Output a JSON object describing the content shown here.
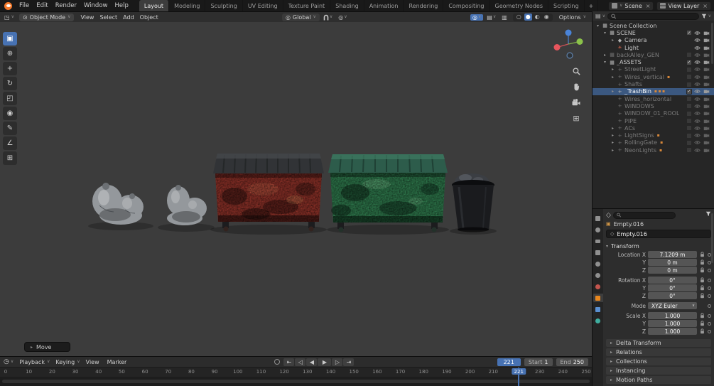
{
  "theme": {
    "bg_topbar": "#191919",
    "bg_header": "#2e2e2e",
    "bg_viewport": "#3c3c3c",
    "bg_panel": "#2d2d2d",
    "bg_outliner": "#262626",
    "bg_field": "#555555",
    "accent": "#4772b3",
    "selection": "#3b5880",
    "text": "#d4d4d4",
    "text_dim": "#8a8a8a",
    "axis_x": "#e8555d",
    "axis_y": "#8bc24a",
    "axis_z": "#4a84d9",
    "dumpster_red": "#8c3128",
    "dumpster_green": "#2f7a4d",
    "bag_gray": "#94989c",
    "can_black": "#1a1b1e"
  },
  "glyphs": {
    "chevron": "∨",
    "close": "×",
    "tree_open": "▾",
    "tree_closed": "▸",
    "editor_3d": "◳",
    "mode_icon": "⊙",
    "clock": "◷",
    "grid": "⊞",
    "proportional": "◎",
    "gizmo": "◎",
    "overlays": "▤",
    "xray": "▥",
    "object_box": "▣",
    "object_data": "◇",
    "list": "▤"
  },
  "topbar": {
    "menus": [
      {
        "label": "File"
      },
      {
        "label": "Edit"
      },
      {
        "label": "Render"
      },
      {
        "label": "Window"
      },
      {
        "label": "Help"
      }
    ],
    "workspaces": [
      {
        "label": "Layout",
        "cls": "active"
      },
      {
        "label": "Modeling"
      },
      {
        "label": "Sculpting"
      },
      {
        "label": "UV Editing"
      },
      {
        "label": "Texture Paint"
      },
      {
        "label": "Shading"
      },
      {
        "label": "Animation"
      },
      {
        "label": "Rendering"
      },
      {
        "label": "Compositing"
      },
      {
        "label": "Geometry Nodes"
      },
      {
        "label": "Scripting"
      },
      {
        "label": "+",
        "cls": "add"
      }
    ],
    "scene_label": "Scene",
    "view_layer_label": "View Layer"
  },
  "viewport_header": {
    "mode": "Object Mode",
    "menus": [
      {
        "label": "View"
      },
      {
        "label": "Select"
      },
      {
        "label": "Add"
      },
      {
        "label": "Object"
      }
    ],
    "orientation": "Global",
    "shading": [
      {
        "name": "shading-wireframe-icon",
        "glyph": "○"
      },
      {
        "name": "shading-solid-icon",
        "glyph": "●",
        "cls": "on"
      },
      {
        "name": "shading-material-icon",
        "glyph": "◐"
      },
      {
        "name": "shading-rendered-icon",
        "glyph": "◉"
      }
    ],
    "options_label": "Options"
  },
  "toolbar": {
    "tools": [
      {
        "name": "tool-select-box",
        "glyph": "▣",
        "cls": "active"
      },
      {
        "name": "tool-cursor",
        "glyph": "⊕"
      },
      {
        "name": "tool-move",
        "glyph": "+"
      },
      {
        "name": "tool-rotate",
        "glyph": "↻"
      },
      {
        "name": "tool-scale",
        "glyph": "◰"
      },
      {
        "name": "tool-transform",
        "glyph": "◉"
      },
      {
        "name": "tool-annotate",
        "glyph": "✎"
      },
      {
        "name": "tool-measure",
        "glyph": "∠"
      },
      {
        "name": "tool-add-cube",
        "glyph": "⊞"
      }
    ]
  },
  "viewport": {
    "operator_label": "Move",
    "objects": [
      {
        "name": "trash-bags-left"
      },
      {
        "name": "trash-bags-center"
      },
      {
        "name": "dumpster-red"
      },
      {
        "name": "dumpster-green"
      },
      {
        "name": "trash-can"
      }
    ]
  },
  "outliner": {
    "search_placeholder": "",
    "rows": [
      {
        "label": "Scene Collection",
        "icon": "▦",
        "arrow": "▾",
        "cls": "ind0 noicons",
        "check": ""
      },
      {
        "label": "SCENE",
        "icon": "▦",
        "arrow": "▾",
        "cls": "ind1",
        "check": "✓"
      },
      {
        "label": "Camera",
        "icon": "◆",
        "arrow": "▸",
        "cls": "ind2 nocheck"
      },
      {
        "label": "Light",
        "icon": "☀",
        "icon_cls": "c-light",
        "arrow": "",
        "cls": "ind2 nocheck"
      },
      {
        "label": "backAlley_GEN",
        "icon": "▦",
        "arrow": "▸",
        "cls": "ind1 dim",
        "check": ""
      },
      {
        "label": "_ASSETS",
        "icon": "▦",
        "arrow": "▾",
        "cls": "ind1",
        "check": "✓"
      },
      {
        "label": "StreetLight",
        "icon": "+",
        "arrow": "▸",
        "cls": "ind2 dim",
        "check": ""
      },
      {
        "label": "Wires_vertical",
        "icon": "+",
        "arrow": "▸",
        "cls": "ind2 dim",
        "check": "",
        "extras": "▪"
      },
      {
        "label": "Shafts",
        "icon": "+",
        "arrow": "",
        "cls": "ind2 dim",
        "check": ""
      },
      {
        "label": "_TrashBin",
        "icon": "+",
        "arrow": "▸",
        "cls": "ind2 sel",
        "check": "✓",
        "extras": "▪▪▪"
      },
      {
        "label": "Wires_horizontal",
        "icon": "+",
        "arrow": "",
        "cls": "ind2 dim",
        "check": ""
      },
      {
        "label": "WINDOWS",
        "icon": "+",
        "arrow": "",
        "cls": "ind2 dim",
        "check": ""
      },
      {
        "label": "WINDOW_01_ROOL",
        "icon": "+",
        "arrow": "",
        "cls": "ind2 dim",
        "check": ""
      },
      {
        "label": "PIPE",
        "icon": "+",
        "arrow": "",
        "cls": "ind2 dim",
        "check": ""
      },
      {
        "label": "ACs",
        "icon": "+",
        "arrow": "▸",
        "cls": "ind2 dim",
        "check": ""
      },
      {
        "label": "LightSigns",
        "icon": "+",
        "arrow": "▸",
        "cls": "ind2 dim",
        "check": "",
        "extras": "▪"
      },
      {
        "label": "RollingGate",
        "icon": "+",
        "arrow": "▸",
        "cls": "ind2 dim",
        "check": "",
        "extras": "▪"
      },
      {
        "label": "NeonLights",
        "icon": "+",
        "arrow": "▸",
        "cls": "ind2 dim",
        "check": "",
        "extras": "▪"
      }
    ]
  },
  "properties": {
    "tabs": [
      {
        "name": "tab-tool",
        "style": "background:#909090"
      },
      {
        "name": "tab-render",
        "style": "background:#909090;border-radius:50%"
      },
      {
        "name": "tab-output",
        "style": "background:#909090;height:5px"
      },
      {
        "name": "tab-view-layer",
        "style": "background:#909090"
      },
      {
        "name": "tab-scene",
        "style": "background:#909090;border-radius:50%"
      },
      {
        "name": "tab-world",
        "style": "background:#909090;border-radius:50%"
      },
      {
        "name": "tab-physics",
        "style": "background:#c4554e;border-radius:50%"
      },
      {
        "name": "tab-object",
        "style": "background:#e8871e",
        "cls": "active"
      },
      {
        "name": "tab-modifiers",
        "style": "background:#5a8fd0"
      },
      {
        "name": "tab-data",
        "style": "background:#3fae9f;border-radius:50%"
      }
    ],
    "search_placeholder": "",
    "breadcrumb": "Empty.016",
    "name_value": "Empty.016",
    "transform_title": "Transform",
    "fields": [
      {
        "label": "Location X",
        "value": "7.1209 m"
      },
      {
        "label": "Y",
        "value": "0 m"
      },
      {
        "label": "Z",
        "value": "0 m"
      },
      {
        "label": "Rotation X",
        "value": "0°",
        "cls": "gap"
      },
      {
        "label": "Y",
        "value": "0°"
      },
      {
        "label": "Z",
        "value": "0°"
      },
      {
        "label": "Mode",
        "value": "XYZ Euler",
        "cls": "gap sel",
        "chev": "∨"
      },
      {
        "label": "Scale X",
        "value": "1.000",
        "cls": "gap"
      },
      {
        "label": "Y",
        "value": "1.000"
      },
      {
        "label": "Z",
        "value": "1.000"
      }
    ],
    "panels": [
      {
        "label": "Delta Transform",
        "arrow": "▸"
      },
      {
        "label": "Relations",
        "arrow": "▸"
      },
      {
        "label": "Collections",
        "arrow": "▸"
      },
      {
        "label": "Instancing",
        "arrow": "▸"
      },
      {
        "label": "Motion Paths",
        "arrow": "▸"
      }
    ]
  },
  "timeline": {
    "menus": [
      {
        "label": "Playback",
        "chev": "∨"
      },
      {
        "label": "Keying",
        "chev": "∨"
      },
      {
        "label": "View"
      },
      {
        "label": "Marker"
      }
    ],
    "transport": [
      {
        "name": "jump-to-start-button",
        "glyph": "⇤"
      },
      {
        "name": "prev-keyframe-button",
        "glyph": "◁"
      },
      {
        "name": "play-reverse-button",
        "glyph": "◀"
      },
      {
        "name": "play-button",
        "glyph": "▶",
        "cls": "play"
      },
      {
        "name": "next-keyframe-button",
        "glyph": "▷"
      },
      {
        "name": "jump-to-end-button",
        "glyph": "⇥"
      }
    ],
    "current_frame": "221",
    "playhead_frame": 221,
    "start_label": "Start",
    "start_value": "1",
    "end_label": "End",
    "end_value": "250",
    "ticks": [
      "0",
      "10",
      "20",
      "30",
      "40",
      "50",
      "60",
      "70",
      "80",
      "90",
      "100",
      "110",
      "120",
      "130",
      "140",
      "150",
      "160",
      "170",
      "180",
      "190",
      "200",
      "210",
      "220",
      "230",
      "240",
      "250"
    ]
  }
}
